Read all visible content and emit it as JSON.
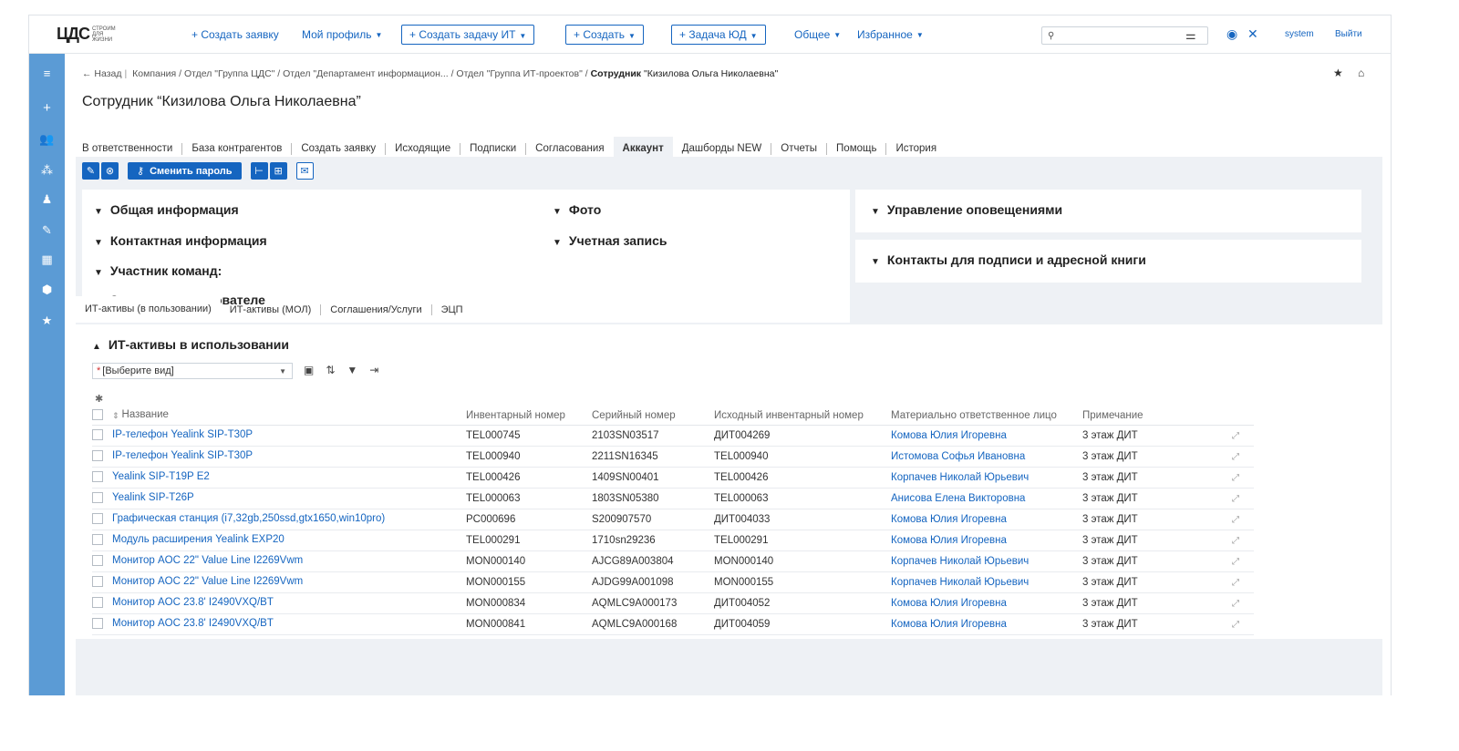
{
  "logo": {
    "mark_left": "ЦДС",
    "sub": "СТРОИМ ДЛЯ ЖИЗНИ"
  },
  "nav": {
    "create_request": "+ Создать заявку",
    "my_profile": "Мой профиль",
    "create_it_task": "+ Создать задачу ИТ",
    "create": "+ Создать",
    "legal_task": "+ Задача ЮД",
    "general": "Общее",
    "favorites": "Избранное",
    "search_placeholder": "",
    "user": "system",
    "logout": "Выйти"
  },
  "breadcrumb": {
    "back": "← Назад",
    "path": "Компания / Отдел \"Группа ЦДС\" / Отдел \"Департамент информацион... / Отдел \"Группа ИТ-проектов\" /",
    "current_prefix": "Сотрудник",
    "current_name": "\"Кизилова Ольга Николаевна\""
  },
  "page_title": "Сотрудник “Кизилова Ольга Николаевна”",
  "tabs": [
    "В ответственности",
    "База контрагентов",
    "Создать заявку",
    "Исходящие",
    "Подписки",
    "Согласования",
    "Аккаунт",
    "Дашборды NEW",
    "Отчеты",
    "Помощь",
    "История"
  ],
  "toolbar": {
    "change_password": "Сменить пароль"
  },
  "sections_left": {
    "general": "Общая информация",
    "contact": "Контактная информация",
    "team": "Участник команд:",
    "notes": "Заметки о пользователе",
    "photo": "Фото",
    "account": "Учетная запись"
  },
  "sections_right": {
    "notifications": "Управление оповещениями",
    "signature": "Контакты для подписи и адресной книги"
  },
  "subtabs": [
    "ИТ-активы (в пользовании)",
    "ИТ-активы (МОЛ)",
    "Соглашения/Услуги",
    "ЭЦП"
  ],
  "assets": {
    "title": "ИТ-активы в использовании",
    "view_placeholder": "[Выберите вид]",
    "columns": {
      "name": "Название",
      "inventory": "Инвентарный номер",
      "serial": "Серийный номер",
      "source_inventory": "Исходный инвентарный номер",
      "responsible": "Материально ответственное лицо",
      "note": "Примечание"
    },
    "rows": [
      {
        "name": "IP-телефон Yealink SIP-T30P",
        "inv": "TEL000745",
        "serial": "2103SN03517",
        "src": "ДИТ004269",
        "person": "Комова Юлия Игоревна",
        "note": "3 этаж ДИТ"
      },
      {
        "name": "IP-телефон Yealink SIP-T30P",
        "inv": "TEL000940",
        "serial": "2211SN16345",
        "src": "TEL000940",
        "person": "Истомова Софья Ивановна",
        "note": "3 этаж ДИТ"
      },
      {
        "name": "Yealink SIP-T19P E2",
        "inv": "TEL000426",
        "serial": "1409SN00401",
        "src": "TEL000426",
        "person": "Корпачев Николай Юрьевич",
        "note": "3 этаж ДИТ"
      },
      {
        "name": "Yealink SIP-T26P",
        "inv": "TEL000063",
        "serial": "1803SN05380",
        "src": "TEL000063",
        "person": "Анисова Елена Викторовна",
        "note": "3 этаж ДИТ"
      },
      {
        "name": "Графическая станция (i7,32gb,250ssd,gtx1650,win10pro)",
        "inv": "PC000696",
        "serial": "S200907570",
        "src": "ДИТ004033",
        "person": "Комова Юлия Игоревна",
        "note": "3 этаж ДИТ"
      },
      {
        "name": "Модуль расширения Yealink EXP20",
        "inv": "TEL000291",
        "serial": "1710sn29236",
        "src": "TEL000291",
        "person": "Комова Юлия Игоревна",
        "note": "3 этаж ДИТ"
      },
      {
        "name": "Монитор AOC 22\" Value Line I2269Vwm",
        "inv": "MON000140",
        "serial": "AJCG89A003804",
        "src": "MON000140",
        "person": "Корпачев Николай Юрьевич",
        "note": "3 этаж ДИТ"
      },
      {
        "name": "Монитор AOC 22\" Value Line I2269Vwm",
        "inv": "MON000155",
        "serial": "AJDG99A001098",
        "src": "MON000155",
        "person": "Корпачев Николай Юрьевич",
        "note": "3 этаж ДИТ"
      },
      {
        "name": "Монитор AOC 23.8' I2490VXQ/BT",
        "inv": "MON000834",
        "serial": "AQMLC9A000173",
        "src": "ДИТ004052",
        "person": "Комова Юлия Игоревна",
        "note": "3 этаж ДИТ"
      },
      {
        "name": "Монитор AOC 23.8' I2490VXQ/BT",
        "inv": "MON000841",
        "serial": "AQMLC9A000168",
        "src": "ДИТ004059",
        "person": "Комова Юлия Игоревна",
        "note": "3 этаж ДИТ"
      }
    ]
  },
  "colors": {
    "accent": "#1565c0",
    "sidebar": "#5b9bd5",
    "panel_bg": "#eef1f5"
  }
}
